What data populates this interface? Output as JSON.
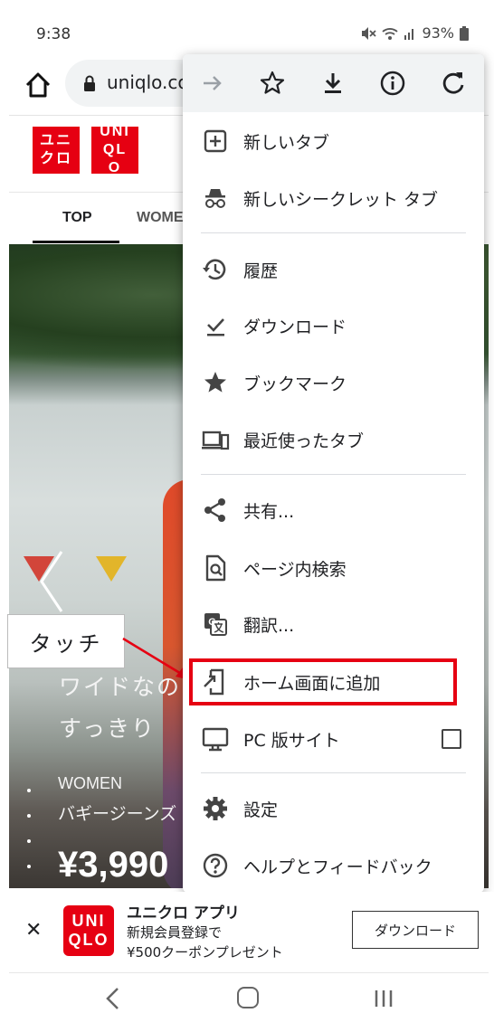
{
  "status_bar": {
    "time": "9:38",
    "battery": "93%"
  },
  "browser": {
    "url": "uniqlo.co"
  },
  "site": {
    "logo_kana": "ユニクロ",
    "logo_latin": "UNIQLO",
    "nav_tabs": [
      "TOP",
      "WOMEN"
    ],
    "hero": {
      "headline_line1": "ワイドなの",
      "headline_line2": "すっきり",
      "category": "WOMEN",
      "product": "バギージーンズ",
      "price": "¥3,990"
    }
  },
  "callout": {
    "text": "タッチ"
  },
  "menu": {
    "items": [
      {
        "label": "新しいタブ",
        "icon": "new-tab-icon"
      },
      {
        "label": "新しいシークレット タブ",
        "icon": "incognito-icon"
      },
      {
        "label": "履歴",
        "icon": "history-icon"
      },
      {
        "label": "ダウンロード",
        "icon": "downloads-icon"
      },
      {
        "label": "ブックマーク",
        "icon": "star-icon"
      },
      {
        "label": "最近使ったタブ",
        "icon": "recent-tabs-icon"
      },
      {
        "label": "共有...",
        "icon": "share-icon"
      },
      {
        "label": "ページ内検索",
        "icon": "find-in-page-icon"
      },
      {
        "label": "翻訳...",
        "icon": "translate-icon"
      },
      {
        "label": "ホーム画面に追加",
        "icon": "add-to-home-icon"
      },
      {
        "label": "PC 版サイト",
        "icon": "desktop-icon"
      },
      {
        "label": "設定",
        "icon": "gear-icon"
      },
      {
        "label": "ヘルプとフィードバック",
        "icon": "help-icon"
      }
    ],
    "desktop_site_checked": false,
    "highlighted_item": "ホーム画面に追加"
  },
  "app_banner": {
    "logo_line1": "UNI",
    "logo_line2": "QLO",
    "title": "ユニクロ アプリ",
    "subtitle_line1": "新規会員登録で",
    "subtitle_line2": "¥500クーポンプレゼント",
    "download_label": "ダウンロード"
  },
  "colors": {
    "uniqlo_red": "#e60012",
    "highlight": "#e60012",
    "menu_bg": "#ffffff",
    "menu_topbar": "#f1f3f4"
  }
}
